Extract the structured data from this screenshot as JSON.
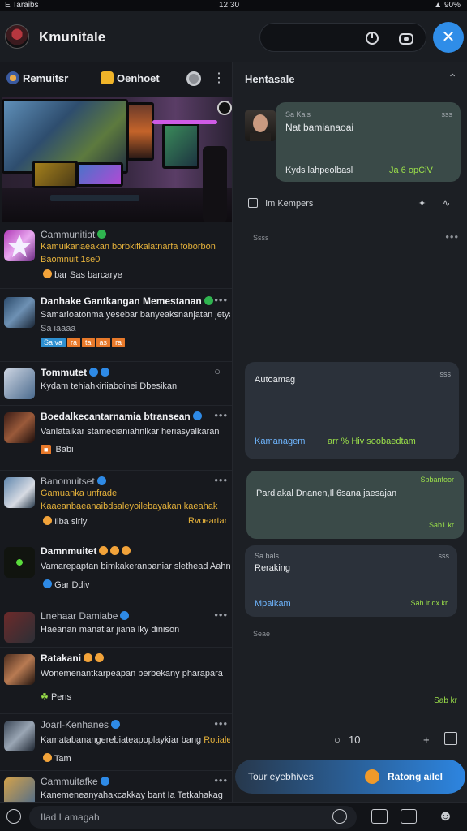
{
  "status_bar": {
    "left": "E Taraibs",
    "time": "12:30",
    "battery": "90%"
  },
  "app": {
    "title": "Kmunitale",
    "colors": {
      "accent": "#2f8de8",
      "background": "#15171c",
      "bubble_green": "#3a4a48"
    }
  },
  "left_tabs": {
    "tab1": "Remuitsr",
    "tab2": "Oenhoet"
  },
  "feed": [
    {
      "name": "Cammunitiat",
      "line1": "Kamuikanaeakan borbkifkalatnarfa foborbon",
      "line2": "Baomnuit 1se0",
      "line3": "bar Sas barcarye"
    },
    {
      "name": "Danhake Gantkangan Memestanan",
      "line1": "Samarioatonma yesebar banyeaksnanjatan jetyan",
      "line2": "Sa iaaaa",
      "tags": [
        "Sa va",
        "ra",
        "ta",
        "as",
        "ra"
      ]
    },
    {
      "name": "Tommutet",
      "line1": "Kydam tehiahkiriiaboinei Dbesikan"
    },
    {
      "name": "Boedalkecantarnamia btransean",
      "line1": "Vanlataikar stamecianiahnlkar heriasyalkaran",
      "line2": "Babi"
    },
    {
      "name": "Banomuitset",
      "line1": "Gamuanka unfrade",
      "line2": "Kaaeanbaeanaibdsaleyoilebayakan kaeahak",
      "line3": "Ilba siriy",
      "line3b": "Rvoeartar"
    },
    {
      "name": "Damnmuitet",
      "line1": "Vamarepaptan bimkakeranpaniar slethead Aahn,",
      "line2": "Gar Ddiv"
    },
    {
      "name": "Lnehaar Damiabe",
      "line1": "Haeanan manatiar jiana lky dinison"
    },
    {
      "name": "Ratakani",
      "line1": "Wonemenantkarpeapan berbekany pharapara",
      "line2": "Pens"
    },
    {
      "name": "Joarl-Kenhanes",
      "line1": "Kamatabanangerebiateapoplaykiar bang",
      "line1b": "Rotiale",
      "line2": "Tam"
    },
    {
      "name": "Cammuitafke",
      "line1": "Kanemeneanyahakcakkay bant Ia Tetkahakag"
    }
  ],
  "chat": {
    "title": "Hentasale",
    "msg1": {
      "meta": "Sa Kals",
      "text": "Nat bamianaoai",
      "time": "sss",
      "footer": "Kyds lahpeolbasl",
      "footer2": "Ja 6 opCiV"
    },
    "row_label": "Im Kempers",
    "sep1": "Ssss",
    "msg2": {
      "title": "Autoamag",
      "time": "sss",
      "footer": "Kamanagem",
      "footer2": "arr % Hiv soobaedtam"
    },
    "msg3": {
      "top": "Sbbanfoor",
      "text": "Pardiakal Dnanen,Il 6sana jaesajan",
      "footer": "Sab1 kr"
    },
    "msg4": {
      "meta": "Sa bals",
      "time": "sss",
      "text": "Reraking",
      "footer": "Mpaikam",
      "footer2": "Sah lr dx kr"
    },
    "sep2": "Seae",
    "tick_text": "Sab kr",
    "counter": "10",
    "cta_label": "Tour eyebhives",
    "cta_action": "Ratong ailel"
  },
  "composer": {
    "placeholder": "Ilad Lamagah"
  }
}
